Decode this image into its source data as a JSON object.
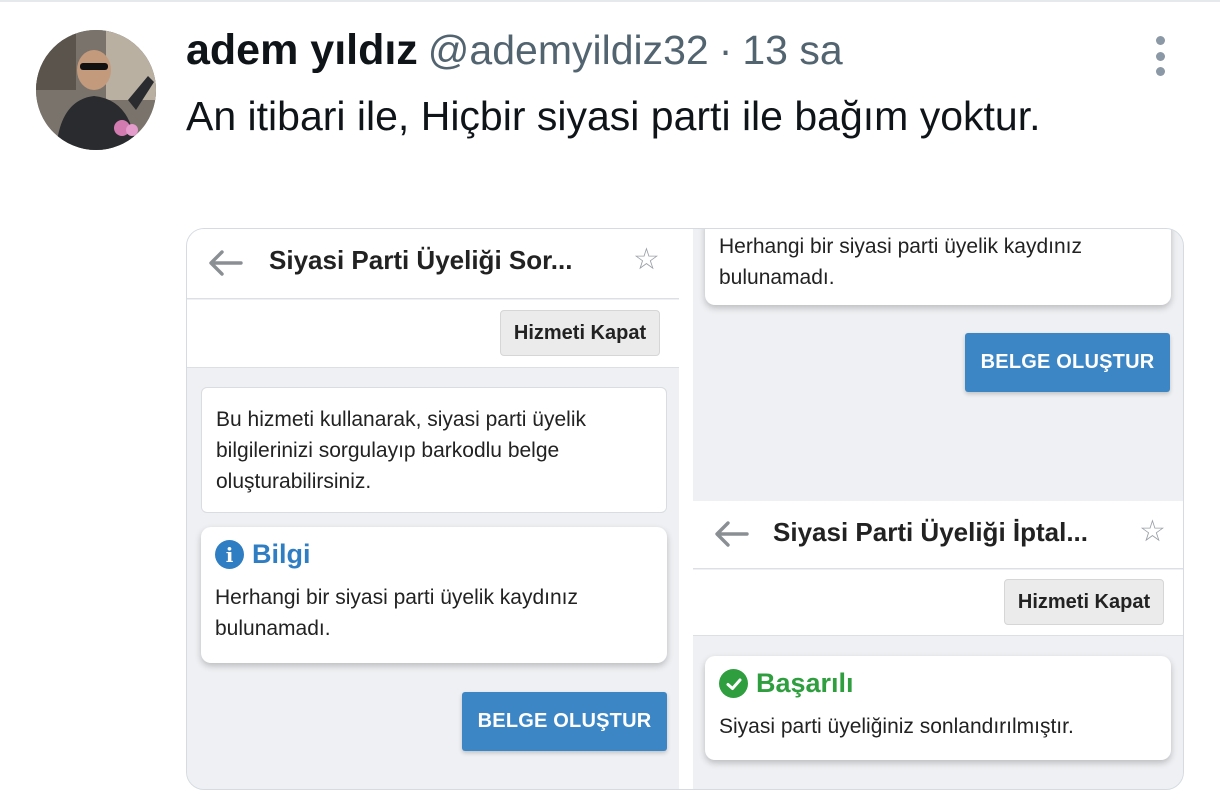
{
  "tweet": {
    "author_name": "adem yıldız",
    "handle": "@ademyildiz32",
    "separator": "·",
    "time": "13 sa",
    "text": "An itibari ile, Hiçbir siyasi parti ile bağım yoktur."
  },
  "panel_left": {
    "title": "Siyasi Parti Üyeliği Sor...",
    "close_button": "Hizmeti Kapat",
    "intro": "Bu hizmeti kullanarak, siyasi parti üyelik bilgilerinizi sorgulayıp barkodlu belge oluşturabilirsiniz.",
    "alert_title": "Bilgi",
    "alert_icon": "info-icon",
    "alert_text": "Herhangi bir siyasi parti üyelik kaydınız bulunamadı.",
    "action_button": "BELGE OLUŞTUR"
  },
  "panel_right_top": {
    "alert_text": "Herhangi bir siyasi parti üyelik kaydınız bulunamadı.",
    "action_button": "BELGE OLUŞTUR"
  },
  "panel_right_bottom": {
    "title": "Siyasi Parti Üyeliği İptal...",
    "close_button": "Hizmeti Kapat",
    "alert_title": "Başarılı",
    "alert_icon": "check-circle-icon",
    "alert_text": "Siyasi parti üyeliğiniz sonlandırılmıştır."
  },
  "colors": {
    "info_blue": "#2f7ec3",
    "success_green": "#2f9e3f",
    "button_blue": "#3d86c6",
    "secondary_text": "#536471"
  }
}
